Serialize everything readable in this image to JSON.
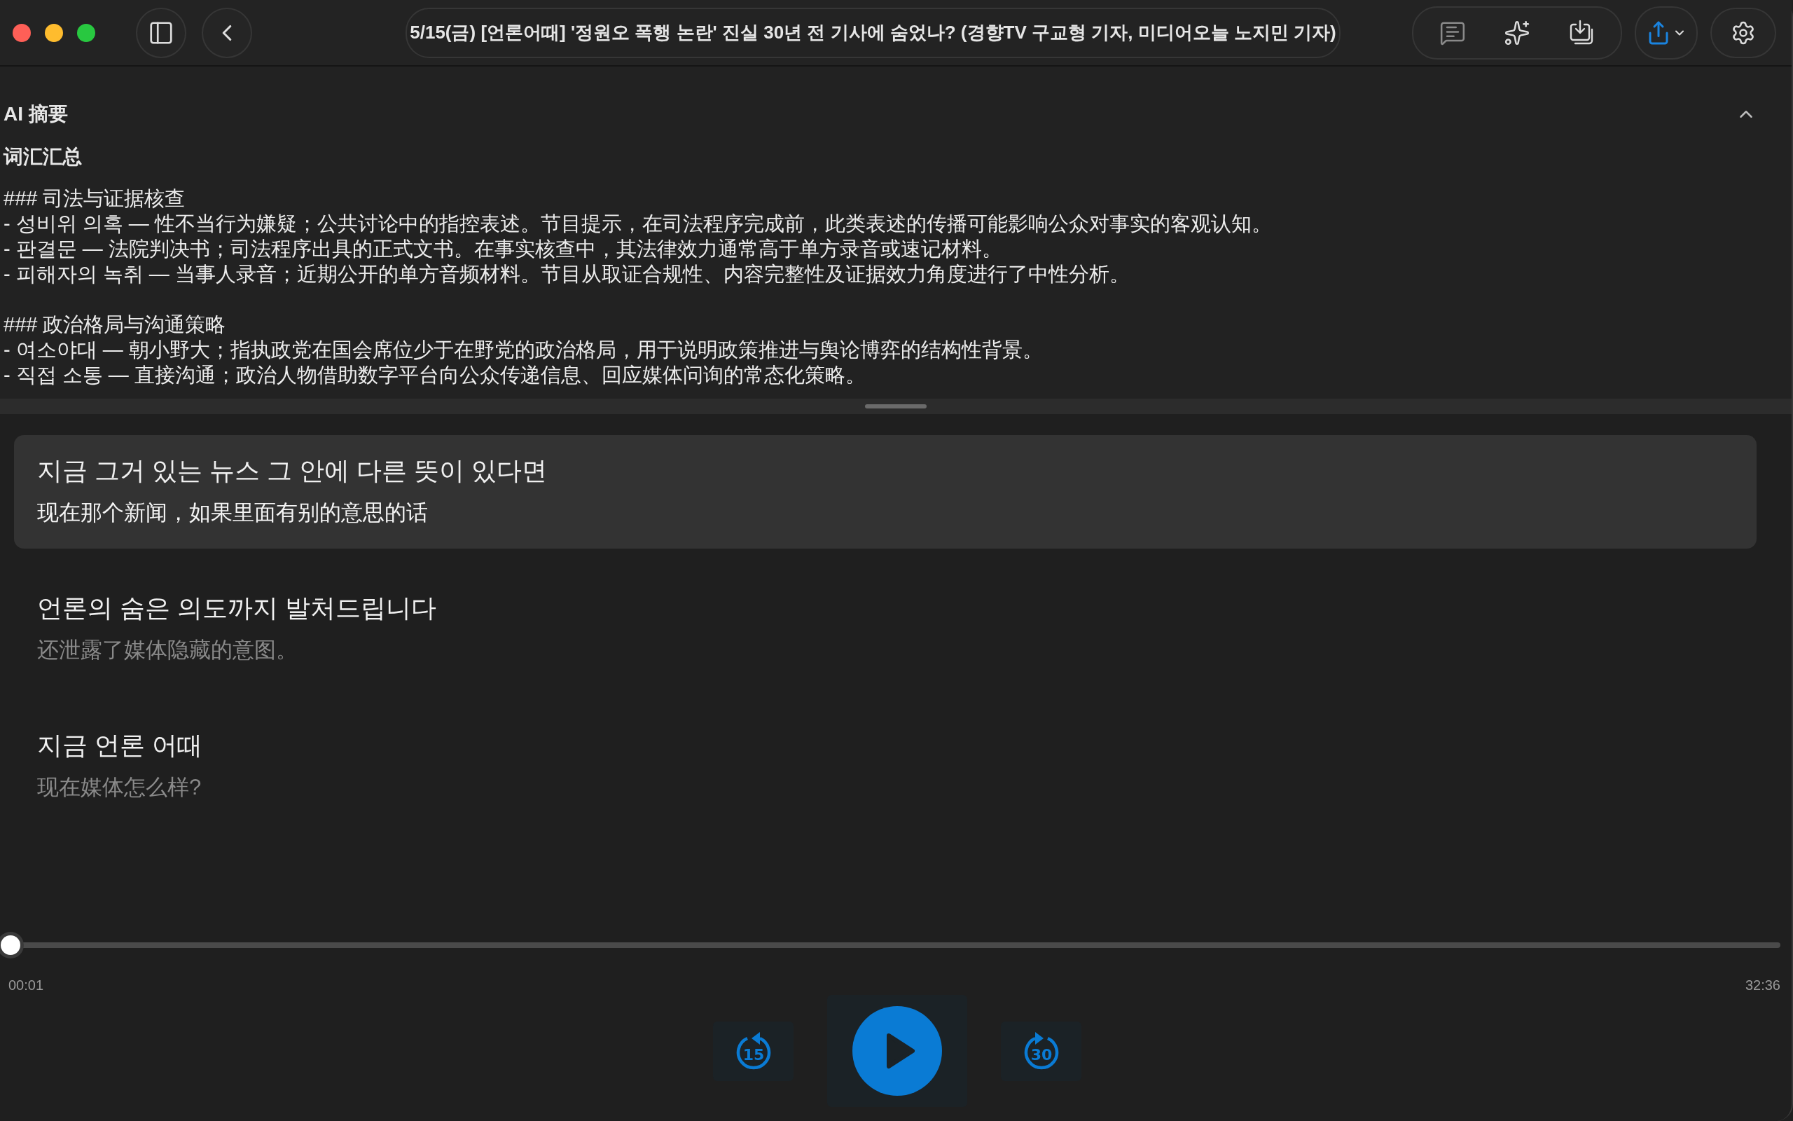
{
  "window": {
    "title": "5/15(금) [언론어때] '정원오 폭행 논란' 진실 30년 전 기사에 숨었나? (경향TV 구교형 기자, 미디어오늘 노지민 기자)"
  },
  "summary": {
    "title": "AI 摘要",
    "expanded": true,
    "heading": "词汇汇总",
    "sections": [
      {
        "heading": "### 司法与证据核查",
        "items": [
          "- 성비위 의혹 — 性不当行为嫌疑；公共讨论中的指控表述。节目提示，在司法程序完成前，此类表述的传播可能影响公众对事实的客观认知。",
          "- 판결문 — 法院判决书；司法程序出具的正式文书。在事实核查中，其法律效力通常高于单方录音或速记材料。",
          "- 피해자의 녹취 — 当事人录音；近期公开的单方音频材料。节目从取证合规性、内容完整性及证据效力角度进行了中性分析。"
        ]
      },
      {
        "heading": "### 政治格局与沟通策略",
        "items": [
          "- 여소야대 — 朝小野大；指执政党在国会席位少于在野党的政治格局，用于说明政策推进与舆论博弈的结构性背景。",
          "- 직접 소통 — 直接沟通；政治人物借助数字平台向公众传递信息、回应媒体问询的常态化策略。"
        ]
      }
    ]
  },
  "subtitles": [
    {
      "original": "지금 그거 있는 뉴스 그 안에 다른 뜻이 있다면",
      "translation": "现在那个新闻，如果里面有别的意思的话",
      "selected": true
    },
    {
      "original": "언론의 숨은 의도까지 발처드립니다",
      "translation": "还泄露了媒体隐藏的意图。",
      "selected": false
    },
    {
      "original": "지금 언론 어때",
      "translation": "现在媒体怎么样?",
      "selected": false
    }
  ],
  "player": {
    "level": 0.0005,
    "elapsed": "00:01",
    "duration": "32:36",
    "skip_back": "15",
    "skip_forward": "30"
  }
}
